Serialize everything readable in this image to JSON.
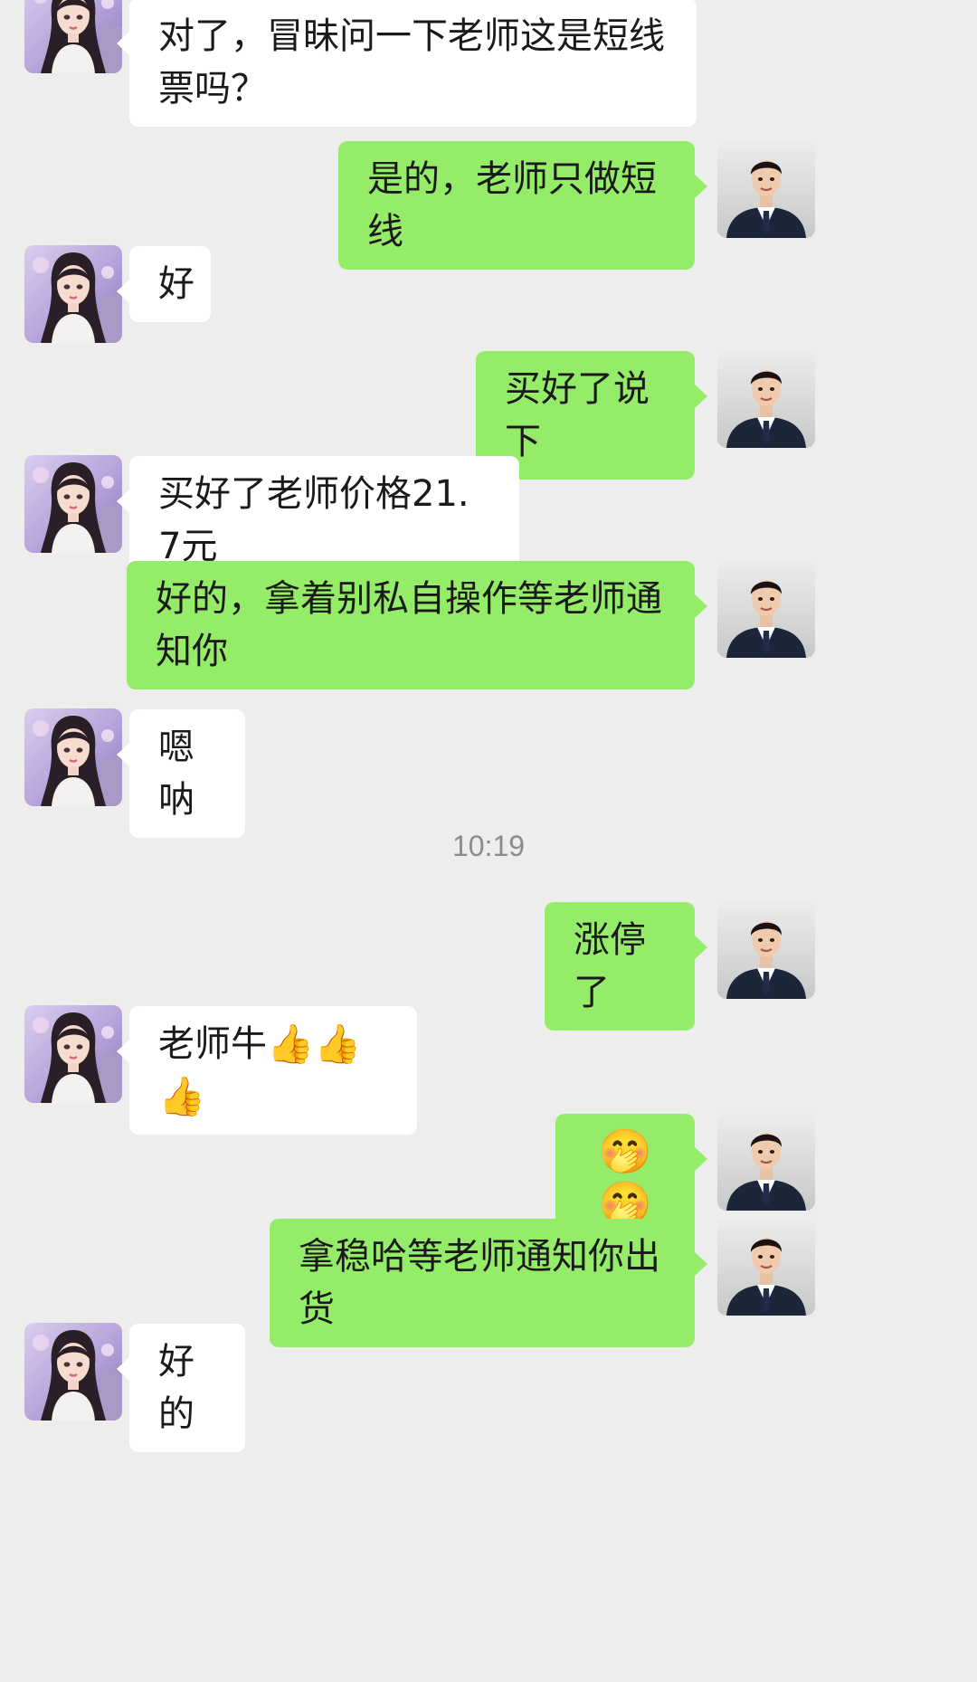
{
  "conversation": {
    "messages": [
      {
        "sender": "student",
        "text": "对了，冒昧问一下老师这是短线票吗？"
      },
      {
        "sender": "teacher",
        "text": "是的，老师只做短线"
      },
      {
        "sender": "student",
        "text": "好"
      },
      {
        "sender": "teacher",
        "text": "买好了说下"
      },
      {
        "sender": "student",
        "text": "买好了老师价格21.7元"
      },
      {
        "sender": "teacher",
        "text": "好的，拿着别私自操作等老师通知你"
      },
      {
        "sender": "student",
        "text": "嗯呐"
      },
      {
        "sender": "teacher",
        "text": "涨停了"
      },
      {
        "sender": "student",
        "text": "老师牛",
        "emojis": [
          "thumbs-up-icon",
          "thumbs-up-icon",
          "thumbs-up-icon"
        ]
      },
      {
        "sender": "teacher",
        "text": "",
        "emojis": [
          "face-with-hand-over-mouth-icon",
          "face-with-hand-over-mouth-icon"
        ]
      },
      {
        "sender": "teacher",
        "text": "拿稳哈等老师通知你出货"
      },
      {
        "sender": "student",
        "text": "好的"
      }
    ],
    "timestamp": "10:19"
  },
  "colors": {
    "background": "#ededed",
    "incoming_bubble": "#ffffff",
    "outgoing_bubble": "#95ec69",
    "timestamp_text": "#8c8c8c"
  },
  "icons": {
    "student_avatar": "student-avatar-icon",
    "teacher_avatar": "teacher-avatar-icon",
    "thumbs_up": "thumbs-up-icon",
    "face": "face-with-hand-over-mouth-icon"
  }
}
